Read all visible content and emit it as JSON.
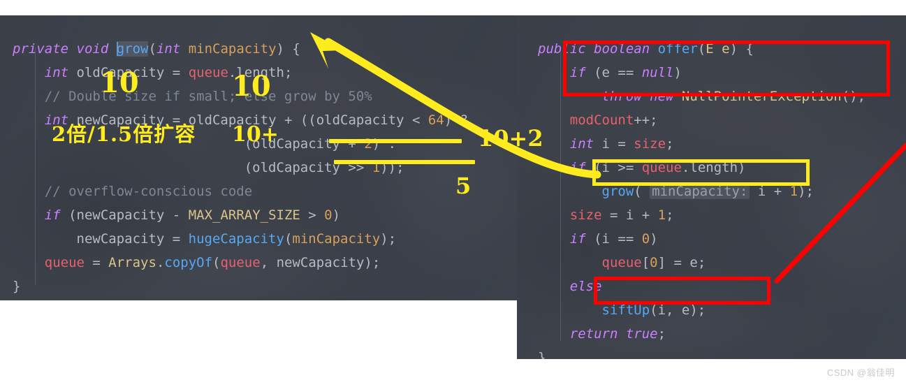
{
  "left_panel": {
    "name": "grow-method-code",
    "lines": [
      [
        {
          "t": "private ",
          "c": "kw"
        },
        {
          "t": "void ",
          "c": "kw"
        },
        {
          "t": "|",
          "c": "caret"
        },
        {
          "t": "grow",
          "c": "fn sel"
        },
        {
          "t": "(",
          "c": "pl"
        },
        {
          "t": "int ",
          "c": "kw"
        },
        {
          "t": "minCapacity",
          "c": "par"
        },
        {
          "t": ") {",
          "c": "pl"
        }
      ],
      [
        {
          "t": "    ",
          "c": "pl"
        },
        {
          "t": "int ",
          "c": "kw"
        },
        {
          "t": "oldCapacity = ",
          "c": "pl"
        },
        {
          "t": "queue",
          "c": "fld"
        },
        {
          "t": ".length;",
          "c": "pl"
        }
      ],
      [
        {
          "t": "    // Double size if small; else grow by 50%",
          "c": "cmt"
        }
      ],
      [
        {
          "t": "    ",
          "c": "pl"
        },
        {
          "t": "int ",
          "c": "kw"
        },
        {
          "t": "newCapacity = oldCapacity + ((oldCapacity < ",
          "c": "pl"
        },
        {
          "t": "64",
          "c": "num"
        },
        {
          "t": ") ?",
          "c": "pl"
        }
      ],
      [
        {
          "t": "                             (oldCapacity + ",
          "c": "pl"
        },
        {
          "t": "2",
          "c": "num"
        },
        {
          "t": ") :",
          "c": "pl"
        }
      ],
      [
        {
          "t": "                             (oldCapacity >> ",
          "c": "pl"
        },
        {
          "t": "1",
          "c": "num"
        },
        {
          "t": "));",
          "c": "pl"
        }
      ],
      [
        {
          "t": "    // overflow-conscious code",
          "c": "cmt"
        }
      ],
      [
        {
          "t": "    ",
          "c": "pl"
        },
        {
          "t": "if ",
          "c": "kw"
        },
        {
          "t": "(newCapacity - ",
          "c": "pl"
        },
        {
          "t": "MAX_ARRAY_SIZE",
          "c": "cls"
        },
        {
          "t": " > ",
          "c": "pl"
        },
        {
          "t": "0",
          "c": "num"
        },
        {
          "t": ")",
          "c": "pl"
        }
      ],
      [
        {
          "t": "        newCapacity = ",
          "c": "pl"
        },
        {
          "t": "hugeCapacity",
          "c": "fn"
        },
        {
          "t": "(",
          "c": "pl"
        },
        {
          "t": "minCapacity",
          "c": "par"
        },
        {
          "t": ");",
          "c": "pl"
        }
      ],
      [
        {
          "t": "    ",
          "c": "pl"
        },
        {
          "t": "queue",
          "c": "fld"
        },
        {
          "t": " = ",
          "c": "pl"
        },
        {
          "t": "Arrays",
          "c": "cls"
        },
        {
          "t": ".",
          "c": "pl"
        },
        {
          "t": "copyOf",
          "c": "fn"
        },
        {
          "t": "(",
          "c": "pl"
        },
        {
          "t": "queue",
          "c": "fld"
        },
        {
          "t": ", newCapacity);",
          "c": "pl"
        }
      ],
      [
        {
          "t": "}",
          "c": "pl"
        }
      ]
    ]
  },
  "right_panel": {
    "name": "offer-method-code",
    "lines": [
      [
        {
          "t": "public ",
          "c": "kw"
        },
        {
          "t": "boolean ",
          "c": "kw"
        },
        {
          "t": "offer",
          "c": "fn"
        },
        {
          "t": "(",
          "c": "pl"
        },
        {
          "t": "E e",
          "c": "cls"
        },
        {
          "t": ") {",
          "c": "pl"
        }
      ],
      [
        {
          "t": "    ",
          "c": "pl"
        },
        {
          "t": "if ",
          "c": "kw"
        },
        {
          "t": "(e == ",
          "c": "pl"
        },
        {
          "t": "null",
          "c": "kw"
        },
        {
          "t": ")",
          "c": "pl"
        }
      ],
      [
        {
          "t": "        ",
          "c": "pl"
        },
        {
          "t": "throw ",
          "c": "kw"
        },
        {
          "t": "new ",
          "c": "kw"
        },
        {
          "t": "NullPointerException",
          "c": "cls"
        },
        {
          "t": "();",
          "c": "pl"
        }
      ],
      [
        {
          "t": "    ",
          "c": "pl"
        },
        {
          "t": "modCount",
          "c": "fld"
        },
        {
          "t": "++;",
          "c": "pl"
        }
      ],
      [
        {
          "t": "    ",
          "c": "pl"
        },
        {
          "t": "int ",
          "c": "kw"
        },
        {
          "t": "i = ",
          "c": "pl"
        },
        {
          "t": "size",
          "c": "fld"
        },
        {
          "t": ";",
          "c": "pl"
        }
      ],
      [
        {
          "t": "    ",
          "c": "pl"
        },
        {
          "t": "if ",
          "c": "kw"
        },
        {
          "t": "(i >= ",
          "c": "pl"
        },
        {
          "t": "queue",
          "c": "fld"
        },
        {
          "t": ".length)",
          "c": "pl"
        }
      ],
      [
        {
          "t": "        ",
          "c": "pl"
        },
        {
          "t": "grow",
          "c": "fn"
        },
        {
          "t": "( ",
          "c": "pl"
        },
        {
          "t": "minCapacity:",
          "c": "hint"
        },
        {
          "t": " i + ",
          "c": "pl"
        },
        {
          "t": "1",
          "c": "num"
        },
        {
          "t": ");",
          "c": "pl"
        }
      ],
      [
        {
          "t": "    ",
          "c": "pl"
        },
        {
          "t": "size",
          "c": "fld"
        },
        {
          "t": " = i + ",
          "c": "pl"
        },
        {
          "t": "1",
          "c": "num"
        },
        {
          "t": ";",
          "c": "pl"
        }
      ],
      [
        {
          "t": "    ",
          "c": "pl"
        },
        {
          "t": "if ",
          "c": "kw"
        },
        {
          "t": "(i == ",
          "c": "pl"
        },
        {
          "t": "0",
          "c": "num"
        },
        {
          "t": ")",
          "c": "pl"
        }
      ],
      [
        {
          "t": "        ",
          "c": "pl"
        },
        {
          "t": "queue",
          "c": "fld"
        },
        {
          "t": "[",
          "c": "pl"
        },
        {
          "t": "0",
          "c": "num"
        },
        {
          "t": "] = e;",
          "c": "pl"
        }
      ],
      [
        {
          "t": "    ",
          "c": "pl"
        },
        {
          "t": "else",
          "c": "kw"
        }
      ],
      [
        {
          "t": "        ",
          "c": "pl"
        },
        {
          "t": "siftUp",
          "c": "fn"
        },
        {
          "t": "(i, e);",
          "c": "pl"
        }
      ],
      [
        {
          "t": "    ",
          "c": "pl"
        },
        {
          "t": "return ",
          "c": "kw"
        },
        {
          "t": "true",
          "c": "kw"
        },
        {
          "t": ";",
          "c": "pl"
        }
      ],
      [
        {
          "t": "}",
          "c": "pl"
        }
      ]
    ]
  },
  "annotations": {
    "ten_left": "10",
    "ten_right": "10",
    "expand_note": "2倍/1.5倍扩容",
    "ten_plus": "10+",
    "ten_plus_two": "10+2",
    "five": "5",
    "arrow_yellow_name": "yellow-curved-arrow",
    "arrow_red_name": "red-diagonal-arrow",
    "box_npe_name": "red-box-null-check",
    "box_grow_name": "yellow-box-grow-call",
    "box_siftup_name": "red-box-siftup-call",
    "underline_1_name": "yellow-underline-oldcapacity-plus-2",
    "underline_2_name": "yellow-underline-oldcapacity-shift-1"
  },
  "colors": {
    "highlight_yellow": "#ffec1f",
    "highlight_red": "#ff0000",
    "editor_bg": "#3c424b",
    "page_bg": "#ffffff"
  },
  "watermark": "CSDN @翁佳明"
}
